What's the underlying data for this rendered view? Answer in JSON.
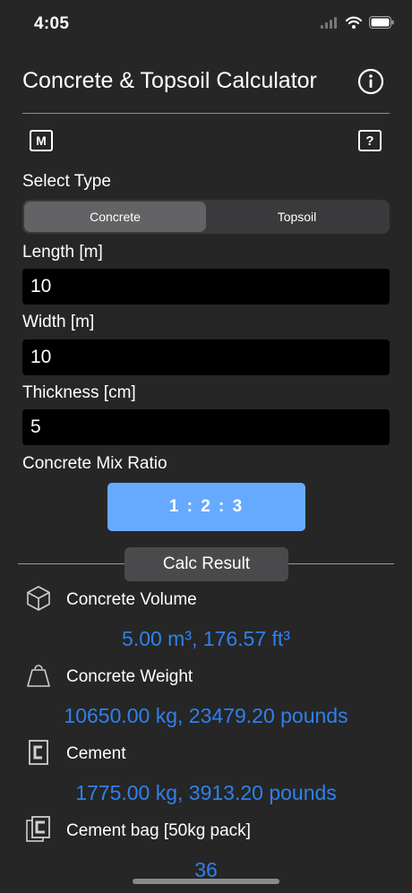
{
  "status": {
    "time": "4:05"
  },
  "header": {
    "title": "Concrete & Topsoil Calculator"
  },
  "toolbar": {
    "m_label": "M",
    "help_label": "?"
  },
  "type_select": {
    "label": "Select Type",
    "options": [
      "Concrete",
      "Topsoil"
    ],
    "selected": "Concrete"
  },
  "fields": {
    "length": {
      "label": "Length [m]",
      "value": "10"
    },
    "width": {
      "label": "Width [m]",
      "value": "10"
    },
    "thickness": {
      "label": "Thickness [cm]",
      "value": "5"
    }
  },
  "mix": {
    "label": "Concrete Mix Ratio",
    "ratio": "1 : 2 : 3"
  },
  "results": {
    "tab_label": "Calc Result",
    "items": [
      {
        "label": "Concrete Volume",
        "value": "5.00 m³, 176.57 ft³",
        "icon": "cube-icon"
      },
      {
        "label": "Concrete Weight",
        "value": "10650.00 kg, 23479.20 pounds",
        "icon": "weight-icon"
      },
      {
        "label": "Cement",
        "value": "1775.00 kg, 3913.20 pounds",
        "icon": "cement-icon"
      },
      {
        "label": "Cement bag [50kg pack]",
        "value": "36",
        "icon": "cement-bag-icon"
      }
    ]
  },
  "colors": {
    "accent": "#66aaff",
    "result_text": "#2f80ed",
    "background": "#262626"
  }
}
